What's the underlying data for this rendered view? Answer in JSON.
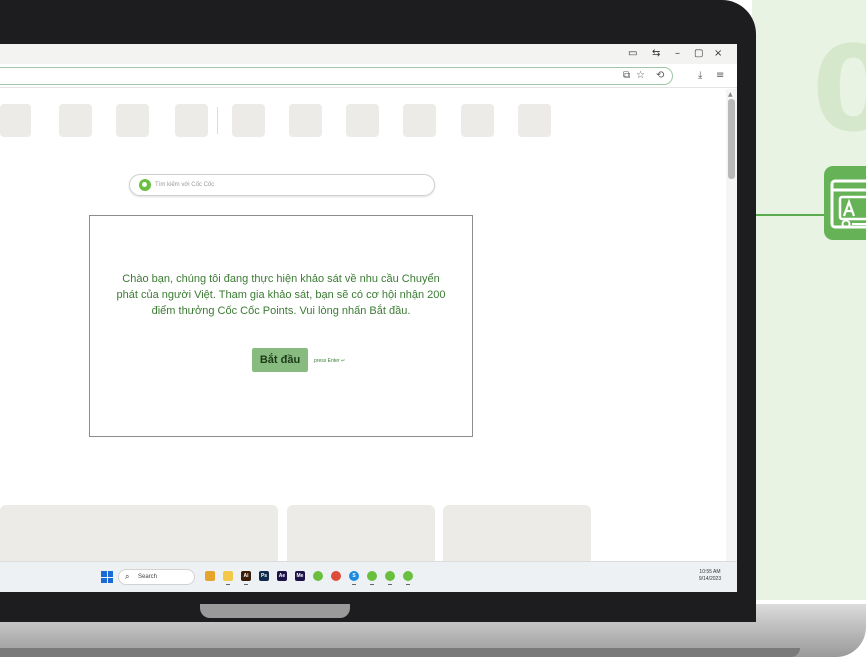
{
  "brand": {
    "big_digit": "0",
    "accent": "#66b357",
    "panel_bg": "#e9f3e3"
  },
  "browser": {
    "window_controls": [
      "▭",
      "⇆",
      "–",
      "▢",
      "×"
    ],
    "toolbar_icons": [
      "⧉",
      "☆",
      "⟲",
      "⤓",
      "≡"
    ]
  },
  "search": {
    "placeholder": "Tìm kiếm với Cốc Cốc"
  },
  "survey": {
    "message": "Chào bạn, chúng tôi đang thực hiện khảo sát về nhu cầu Chuyển phát của người Việt. Tham gia khảo sát, bạn sẽ có cơ hội nhận 200 điểm thưởng Cốc Cốc Points. Vui lòng nhấn Bắt đầu.",
    "start_label": "Bắt đầu",
    "enter_hint": "press Enter ↵",
    "text_color": "#3b7c33",
    "button_color": "#87bb7f"
  },
  "taskbar": {
    "search_icon": "⌕",
    "search_label": "Search",
    "apps": [
      {
        "name": "explorer-app",
        "glyph": "",
        "color": "#e5a52c"
      },
      {
        "name": "folder-app",
        "glyph": "",
        "color": "#f2c84b"
      },
      {
        "name": "illustrator-app",
        "glyph": "Ai",
        "color": "#3a1b06"
      },
      {
        "name": "photoshop-app",
        "glyph": "Ps",
        "color": "#0f2a4a"
      },
      {
        "name": "after-effects-app",
        "glyph": "Ae",
        "color": "#1c1248"
      },
      {
        "name": "media-encoder-app",
        "glyph": "Me",
        "color": "#1c1248"
      },
      {
        "name": "coccoc-app",
        "glyph": "",
        "color": "#6abf3f"
      },
      {
        "name": "chrome-app",
        "glyph": "",
        "color": "#dd4b39"
      },
      {
        "name": "skype-app",
        "glyph": "S",
        "color": "#1a8ce0"
      },
      {
        "name": "coccoc-app-2",
        "glyph": "",
        "color": "#6abf3f"
      },
      {
        "name": "coccoc-app-3",
        "glyph": "",
        "color": "#6abf3f"
      },
      {
        "name": "coccoc-app-4",
        "glyph": "",
        "color": "#6abf3f"
      }
    ],
    "time": "10:55 AM",
    "date": "9/14/2023"
  }
}
